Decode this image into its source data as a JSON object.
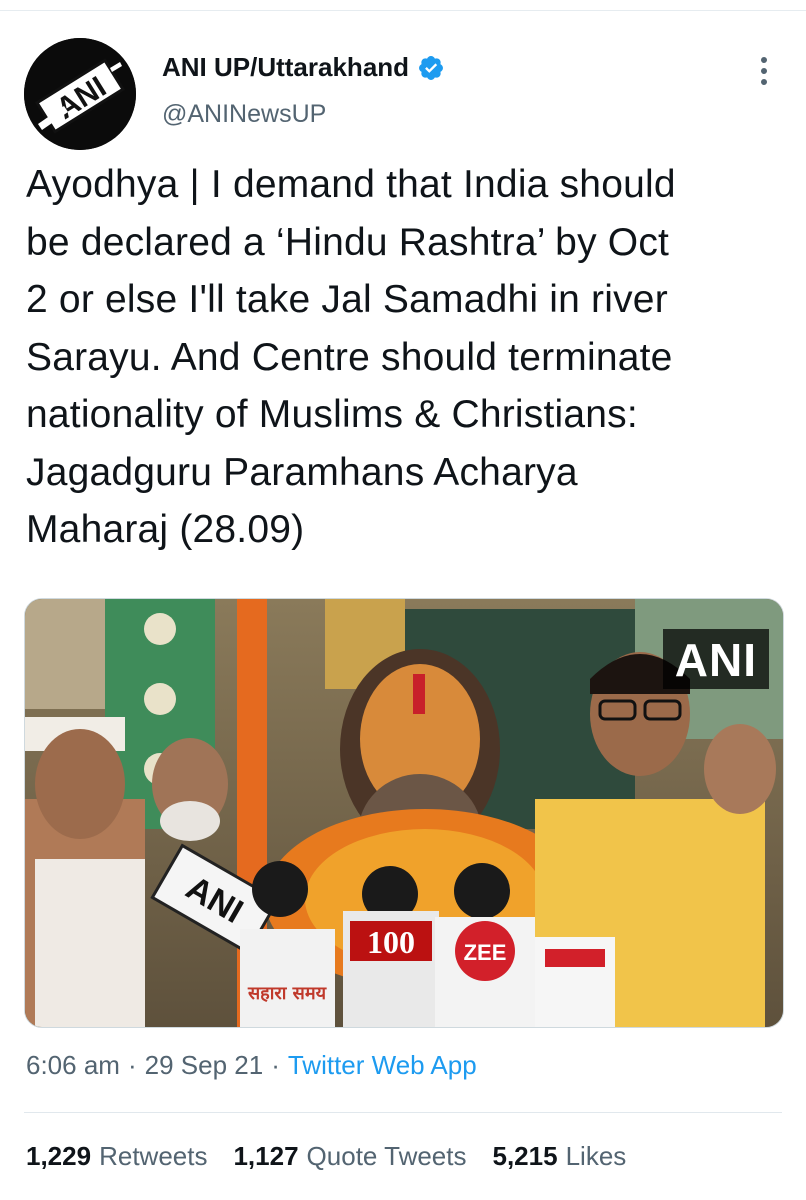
{
  "tweet": {
    "author": {
      "display_name": "ANI UP/Uttarakhand",
      "handle": "@ANINewsUP",
      "avatar_text": "ANI",
      "verified_icon": "verified-badge-icon"
    },
    "text": "Ayodhya | I demand that India should\nbe declared a ‘Hindu Rashtra’ by Oct\n2 or else I'll take Jal Samadhi in river\nSarayu. And Centre should terminate\nnationality of Muslims & Christians:\nJagadguru Paramhans Acharya\nMaharaj (28.09)",
    "media": {
      "watermark": "ANI",
      "mic_labels": [
        "ANI",
        "100",
        "ZEE",
        "सहारा समय"
      ]
    },
    "meta": {
      "time": "6:06 am",
      "date": "29 Sep 21",
      "source": "Twitter Web App",
      "separator": "·"
    },
    "stats": {
      "retweets_count": "1,229",
      "retweets_label": "Retweets",
      "quotes_count": "1,127",
      "quotes_label": "Quote Tweets",
      "likes_count": "5,215",
      "likes_label": "Likes"
    }
  },
  "colors": {
    "accent": "#1d9bf0",
    "text": "#0f1419",
    "secondary": "#536471"
  }
}
